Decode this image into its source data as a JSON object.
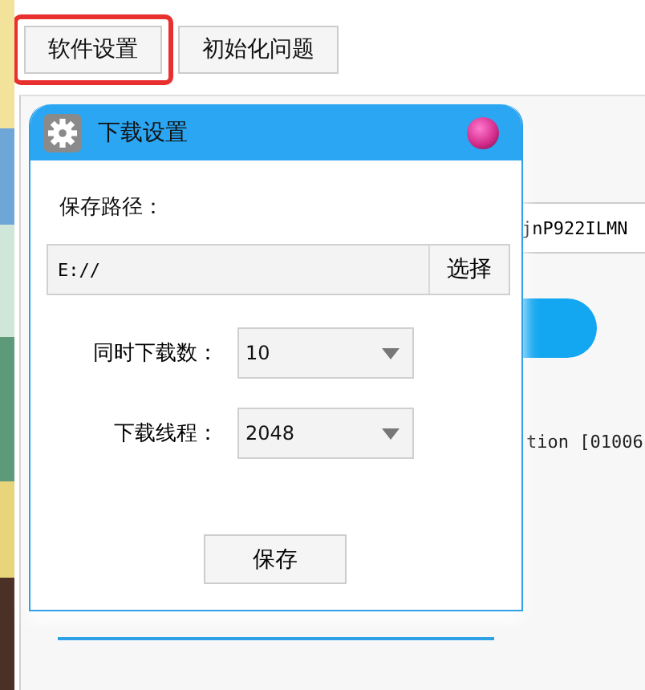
{
  "tabs": [
    {
      "label": "软件设置",
      "highlighted": true
    },
    {
      "label": "初始化问题",
      "highlighted": false
    }
  ],
  "background": {
    "field_value": "jnP922ILMN",
    "log_text": "tion [01006"
  },
  "dialog": {
    "title": "下载设置",
    "path_label": "保存路径：",
    "path_value": "E://",
    "choose_button": "选择",
    "rows": [
      {
        "label": "同时下载数：",
        "value": "10"
      },
      {
        "label": "下载线程：",
        "value": "2048"
      }
    ],
    "save_button": "保存"
  }
}
